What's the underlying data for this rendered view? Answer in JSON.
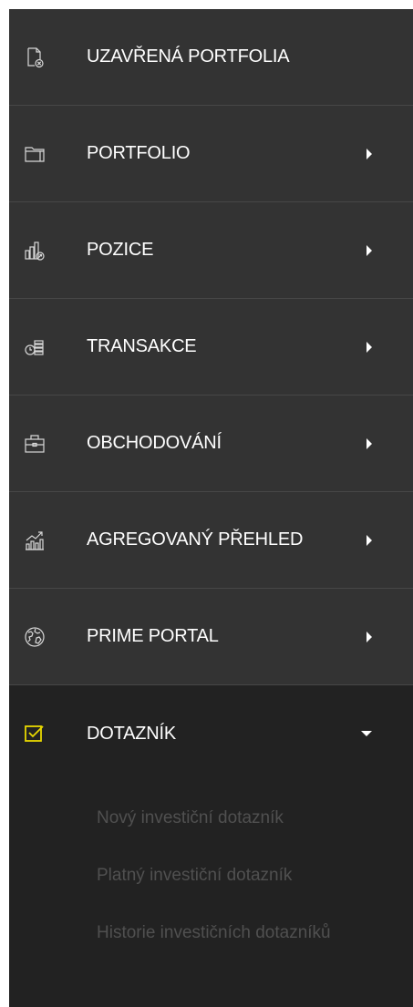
{
  "menu": {
    "items": [
      {
        "label": "UZAVŘENÁ PORTFOLIA",
        "icon": "closed-file-icon",
        "has_arrow": false
      },
      {
        "label": "PORTFOLIO",
        "icon": "folder-icon",
        "has_arrow": true
      },
      {
        "label": "POZICE",
        "icon": "chart-positions-icon",
        "has_arrow": true
      },
      {
        "label": "TRANSAKCE",
        "icon": "transaction-coins-icon",
        "has_arrow": true
      },
      {
        "label": "OBCHODOVÁNÍ",
        "icon": "briefcase-icon",
        "has_arrow": true
      },
      {
        "label": "AGREGOVANÝ PŘEHLED",
        "icon": "growth-chart-icon",
        "has_arrow": true
      },
      {
        "label": "PRIME PORTAL",
        "icon": "globe-icon",
        "has_arrow": true
      },
      {
        "label": "DOTAZNÍK",
        "icon": "checkbox-icon",
        "expanded": true
      }
    ],
    "submenu": [
      {
        "label": "Nový investiční dotazník"
      },
      {
        "label": "Platný investiční dotazník"
      },
      {
        "label": "Historie investičních dotazníků"
      }
    ]
  },
  "colors": {
    "background": "#333333",
    "active_background": "#222222",
    "accent": "#e8d800",
    "text": "#ffffff",
    "submenu_text": "#505050"
  }
}
